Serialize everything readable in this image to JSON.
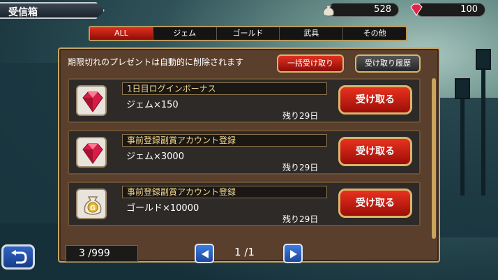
{
  "header": {
    "title": "受信箱"
  },
  "currency": {
    "coins": "528",
    "gems": "100"
  },
  "tabs": [
    "ALL",
    "ジェム",
    "ゴールド",
    "武具",
    "その他"
  ],
  "panel": {
    "notice": "期限切れのプレゼントは自動的に削除されます",
    "bulk_claim_label": "一括受け取り",
    "history_label": "受け取り履歴"
  },
  "items": [
    {
      "name": "1日目ログインボーナス",
      "desc": "ジェム×150",
      "remain": "残り29日",
      "claim": "受け取る",
      "icon": "gem-icon"
    },
    {
      "name": "事前登録副賞アカウント登録",
      "desc": "ジェム×3000",
      "remain": "残り29日",
      "claim": "受け取る",
      "icon": "gem-icon"
    },
    {
      "name": "事前登録副賞アカウント登録",
      "desc": "ゴールド×10000",
      "remain": "残り29日",
      "claim": "受け取る",
      "icon": "gold-bag-icon"
    }
  ],
  "footer": {
    "count": "3 /999",
    "page": "1 /1"
  },
  "colors": {
    "accent_red": "#d42a1a",
    "frame_gold": "#c8a463",
    "button_blue": "#2f65c4"
  }
}
